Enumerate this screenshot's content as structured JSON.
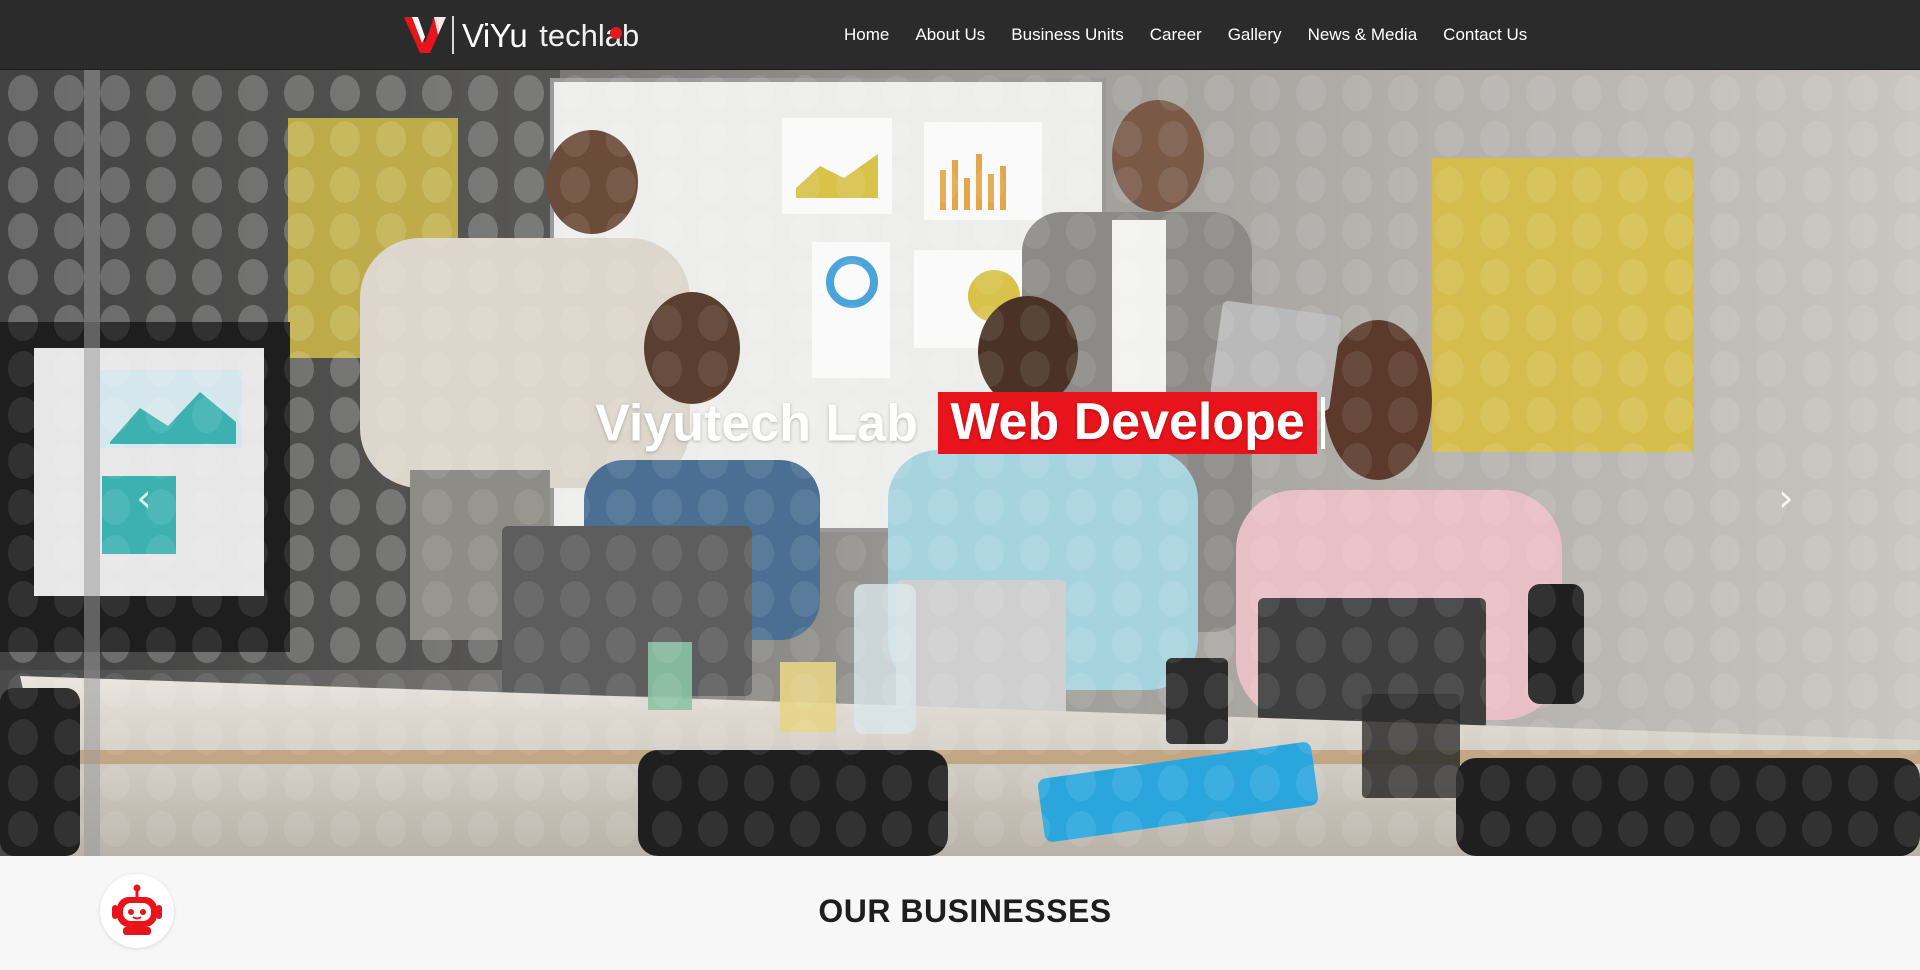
{
  "brand": {
    "name": "ViYu",
    "suffix": "techlab",
    "accent_color": "#e8141c",
    "nav_bg": "#2b2b2b"
  },
  "nav": {
    "items": [
      "Home",
      "About Us",
      "Business Units",
      "Career",
      "Gallery",
      "News & Media",
      "Contact Us"
    ]
  },
  "hero": {
    "title_prefix": "Viyutech Lab",
    "title_highlight": "Web Develope",
    "prev_icon": "chevron-left-icon",
    "next_icon": "chevron-right-icon",
    "prev_glyph": "‹",
    "next_glyph": "›"
  },
  "section": {
    "title": "OUR BUSINESSES",
    "badge_icon": "robot-icon"
  }
}
